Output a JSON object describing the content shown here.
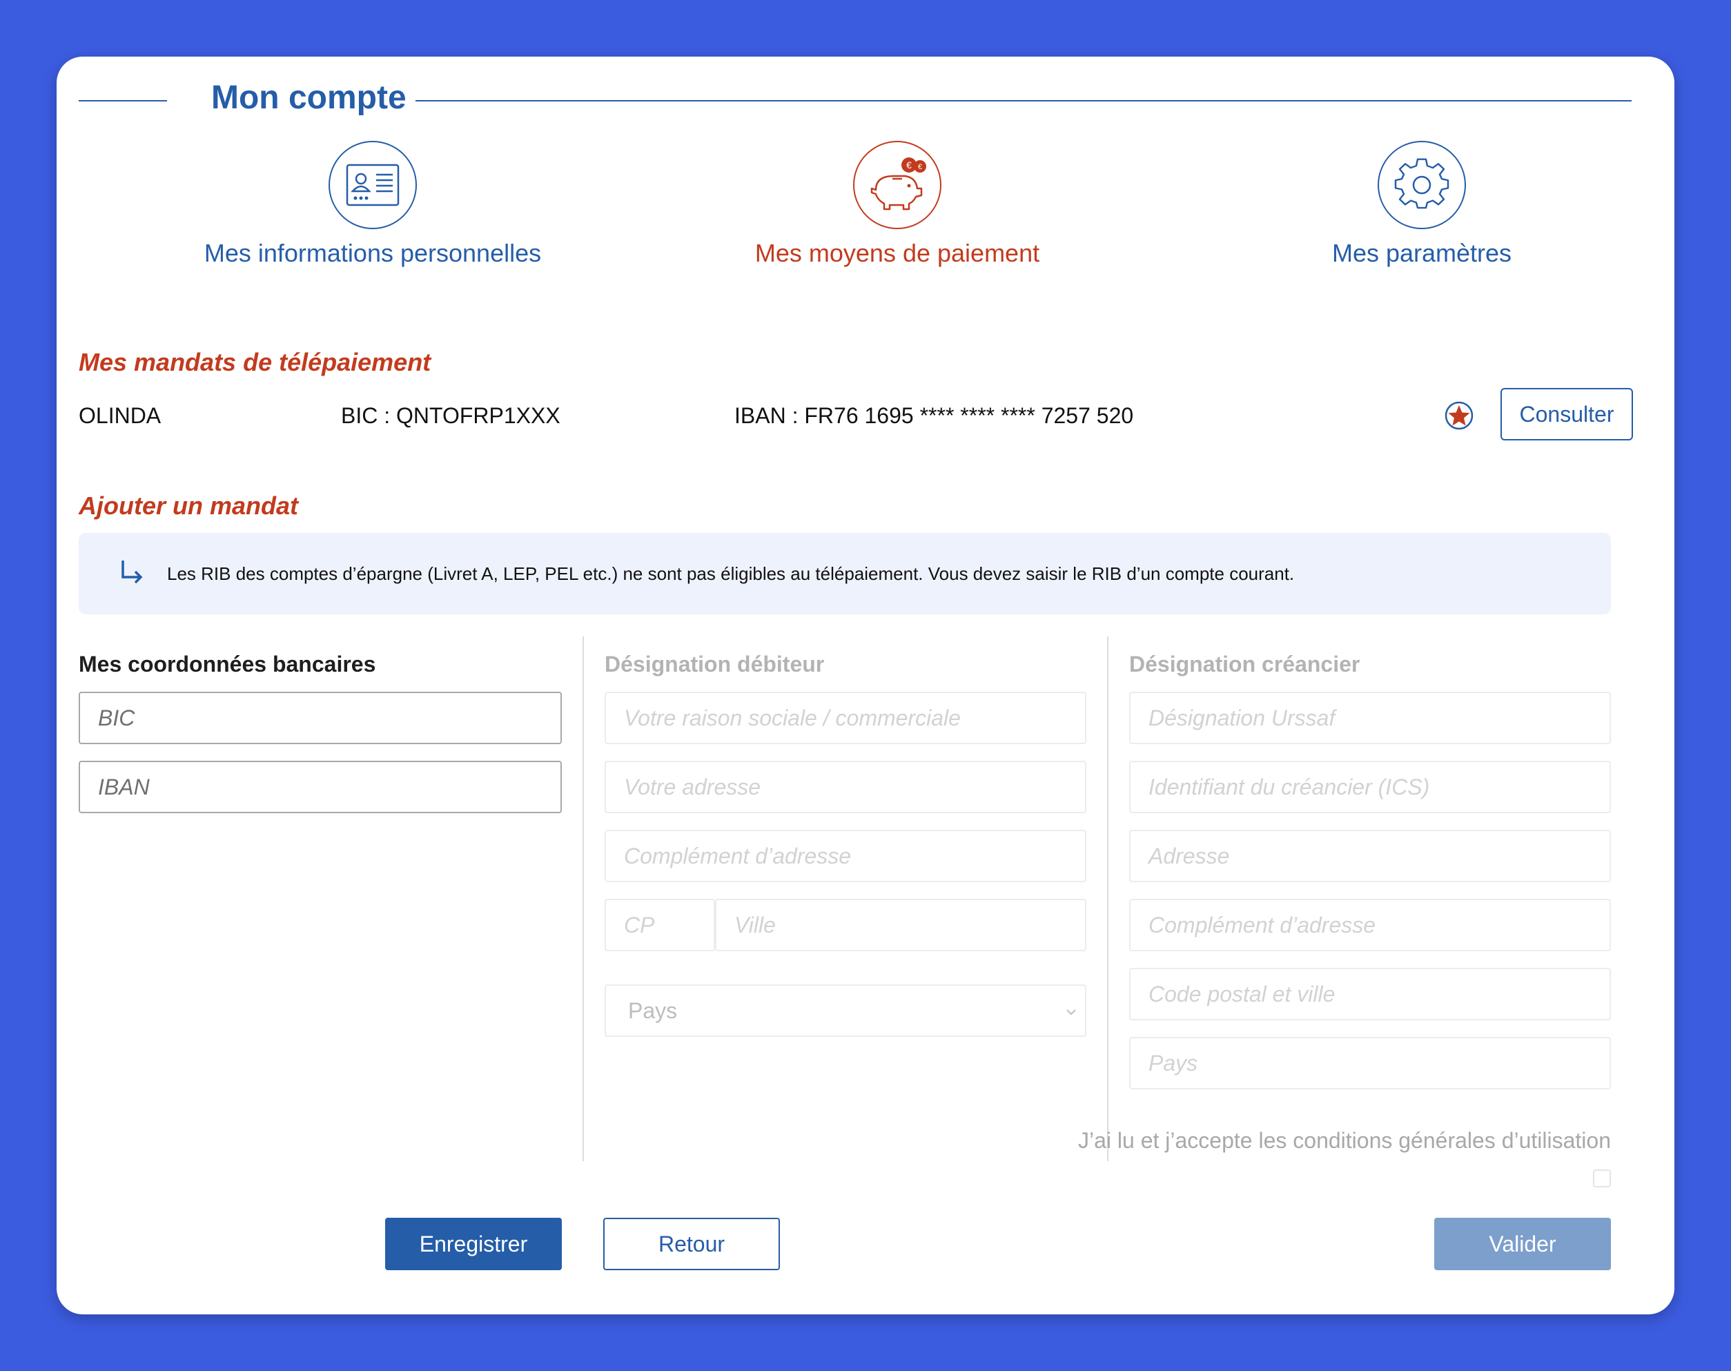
{
  "page": {
    "title": "Mon compte"
  },
  "nav": [
    {
      "label": "Mes informations personnelles",
      "icon": "id-card-icon",
      "active": false
    },
    {
      "label": "Mes moyens de paiement",
      "icon": "piggy-bank-euro-icon",
      "active": true
    },
    {
      "label": "Mes paramètres",
      "icon": "gear-icon",
      "active": false
    }
  ],
  "mandates": {
    "title": "Mes mandats de télépaiement",
    "items": [
      {
        "name": "OLINDA",
        "bic": "BIC : QNTOFRP1XXX",
        "iban": "IBAN : FR76 1695 **** **** **** 7257 520",
        "favorite_icon": "star-icon",
        "action_label": "Consulter"
      }
    ]
  },
  "add_mandate": {
    "title": "Ajouter un mandat",
    "info_icon": "arrow-turn-right-icon",
    "info_text": "Les RIB des comptes d’épargne (Livret A, LEP, PEL etc.) ne sont pas éligibles au télépaiement. Vous devez saisir le RIB d’un compte courant."
  },
  "bank_details": {
    "title": "Mes coordonnées bancaires",
    "bic_placeholder": "BIC",
    "iban_placeholder": "IBAN"
  },
  "debtor": {
    "title": "Désignation débiteur",
    "company_placeholder": "Votre raison sociale / commerciale",
    "address_placeholder": "Votre adresse",
    "address_extra_placeholder": "Complément d’adresse",
    "zip_placeholder": "CP",
    "city_placeholder": "Ville",
    "country_selected": "Pays"
  },
  "creditor": {
    "title": "Désignation créancier",
    "designation_placeholder": "Désignation Urssaf",
    "ics_placeholder": "Identifiant du créancier (ICS)",
    "address_placeholder": "Adresse",
    "address_extra_placeholder": "Complément d’adresse",
    "zip_city_placeholder": "Code postal et ville",
    "country_placeholder": "Pays"
  },
  "cgu": {
    "label": "J’ai lu et j’accepte les conditions générales d’utilisation",
    "checked": false
  },
  "actions": {
    "save_label": "Enregistrer",
    "back_label": "Retour",
    "validate_label": "Valider"
  },
  "colors": {
    "primary_blue": "#255da8",
    "accent_red": "#c23b1e",
    "background": "#3c5ce0",
    "info_bg": "#eef2fd",
    "validate_disabled": "#7c9fcc"
  }
}
